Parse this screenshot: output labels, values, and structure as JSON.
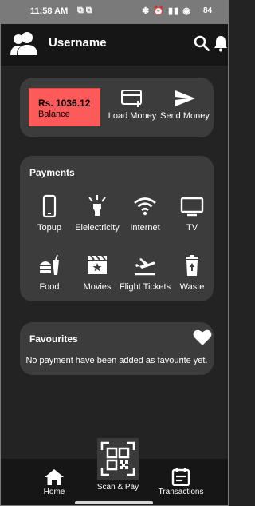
{
  "status_bar": {
    "time": "11:58 AM",
    "left_icons": "⧉ ⧉",
    "right_icons": "✱ ⏰ ▮▮ ◉",
    "battery": "84"
  },
  "app_bar": {
    "title": "Username"
  },
  "wallet": {
    "balance_amount": "Rs. 1036.12",
    "balance_label": "Balance",
    "load_money_label": "Load Money",
    "send_money_label": "Send Money",
    "balance_color": "#ff5a5a"
  },
  "payments": {
    "title": "Payments",
    "items": [
      {
        "label": "Topup",
        "icon": "phone-icon"
      },
      {
        "label": "Elelectricity",
        "icon": "bulb-icon"
      },
      {
        "label": "Internet",
        "icon": "wifi-icon"
      },
      {
        "label": "TV",
        "icon": "tv-icon"
      },
      {
        "label": "Food",
        "icon": "food-icon"
      },
      {
        "label": "Movies",
        "icon": "movie-icon"
      },
      {
        "label": "Flight Tickets",
        "icon": "flight-icon"
      },
      {
        "label": "Waste",
        "icon": "waste-icon"
      }
    ]
  },
  "favourites": {
    "title": "Favourites",
    "empty_message": "No payment have been added as favourite yet."
  },
  "bottom_nav": {
    "home_label": "Home",
    "scan_pay_label": "Scan & Pay",
    "transactions_label": "Transactions"
  }
}
